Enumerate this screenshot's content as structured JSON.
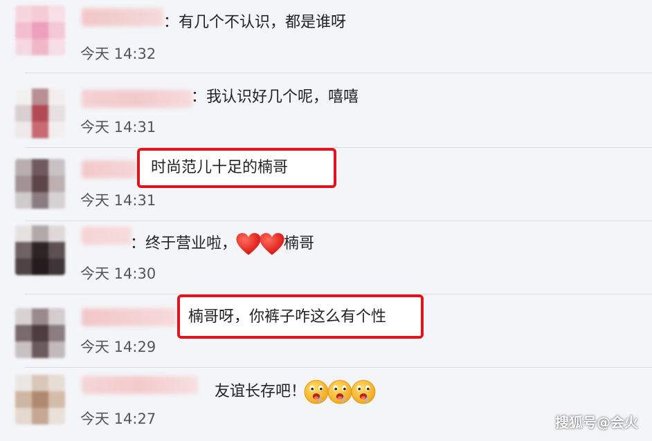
{
  "comments": [
    {
      "text": "有几个不认识，都是谁呀",
      "time": "今天 14:32"
    },
    {
      "text": "我认识好几个呢，嘻嘻",
      "time": "今天 14:31"
    },
    {
      "text": "时尚范儿十足的楠哥",
      "time": "今天 14:31"
    },
    {
      "text_before": "终于营业啦，",
      "text_after": "楠哥",
      "time": "今天 14:30"
    },
    {
      "text": "楠哥呀，你裤子咋这么有个性",
      "time": "今天 14:29"
    },
    {
      "text": "友谊长存吧！",
      "time": "今天 14:27"
    }
  ],
  "colon": "：",
  "watermark": "搜狐号@会火",
  "icons": {
    "heart": "heart-icon",
    "emoji": "drooling-face-icon"
  },
  "colors": {
    "highlight": "#e0141c",
    "heart": "#e5231b",
    "background": "#f4f5f8"
  }
}
